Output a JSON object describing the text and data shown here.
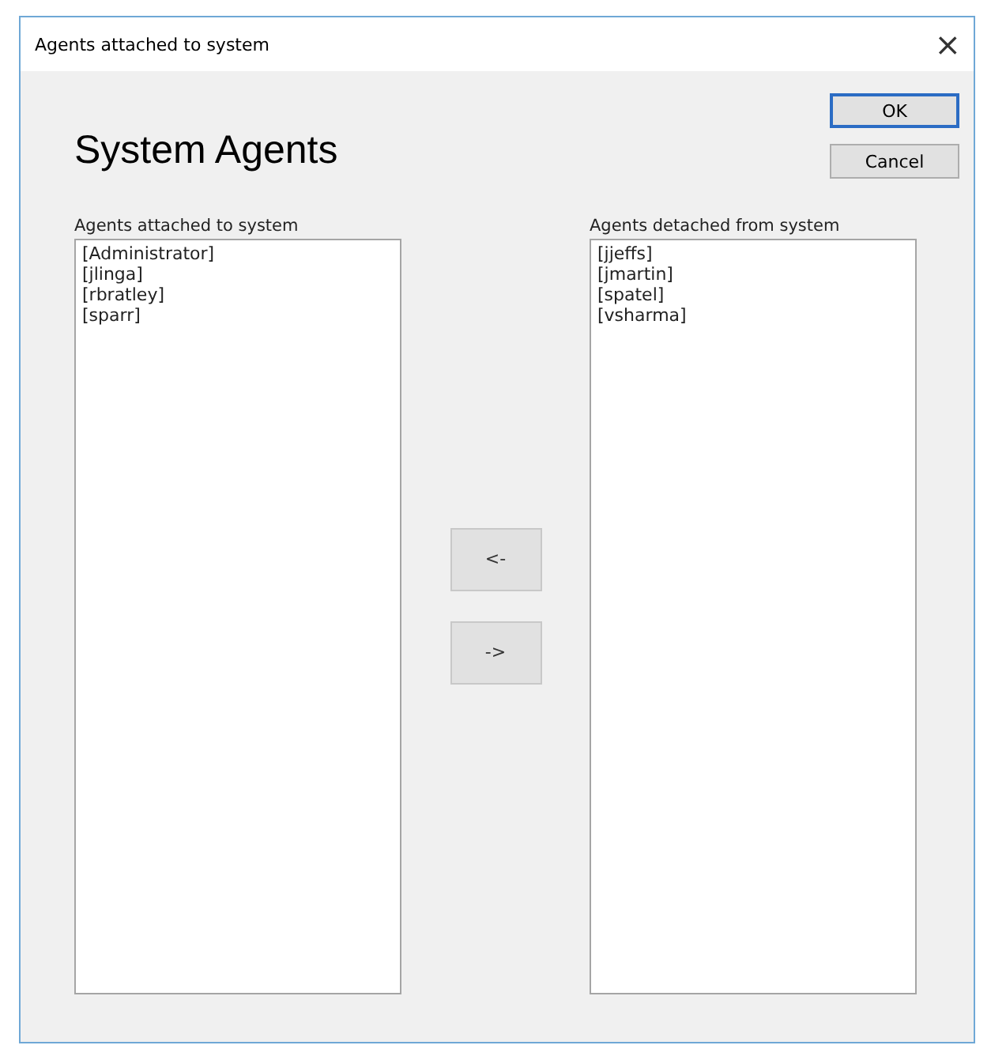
{
  "window": {
    "title": "Agents attached to system",
    "close": "×"
  },
  "heading": "System Agents",
  "buttons": [
    {
      "label": "OK",
      "default": true
    },
    {
      "label": "Cancel",
      "default": false
    }
  ],
  "attached": {
    "label": "Agents attached to system",
    "items": [
      "[Administrator]",
      "[jlinga]",
      "[rbratley]",
      "[sparr]"
    ]
  },
  "move_buttons": [
    "<-",
    "->"
  ],
  "detached": {
    "label": "Agents detached from system",
    "items": [
      "[jjeffs]",
      "[jmartin]",
      "[spatel]",
      "[vsharma]"
    ]
  }
}
